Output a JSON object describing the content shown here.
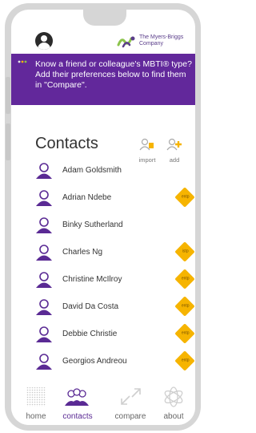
{
  "header": {
    "logo_text": "The Myers-Briggs Company"
  },
  "banner": {
    "message": "Know a friend or colleague's MBTI® type? Add their preferences below to find them in \"Compare\"."
  },
  "contacts": {
    "title": "Contacts",
    "import_label": "import",
    "add_label": "add",
    "items": [
      {
        "name": "Adam Goldsmith",
        "type": ""
      },
      {
        "name": "Adrian Ndebe",
        "type": "entp"
      },
      {
        "name": "Binky Sutherland",
        "type": ""
      },
      {
        "name": "Charles Ng",
        "type": "istp"
      },
      {
        "name": "Christine McIlroy",
        "type": "entp"
      },
      {
        "name": "David Da Costa",
        "type": "entp"
      },
      {
        "name": "Debbie Christie",
        "type": "entp"
      },
      {
        "name": "Georgios Andreou",
        "type": "entp"
      }
    ]
  },
  "nav": {
    "home": "home",
    "contacts": "contacts",
    "compare": "compare",
    "about": "about"
  },
  "colors": {
    "brand_purple": "#62289b",
    "accent_gold": "#f6b400"
  }
}
